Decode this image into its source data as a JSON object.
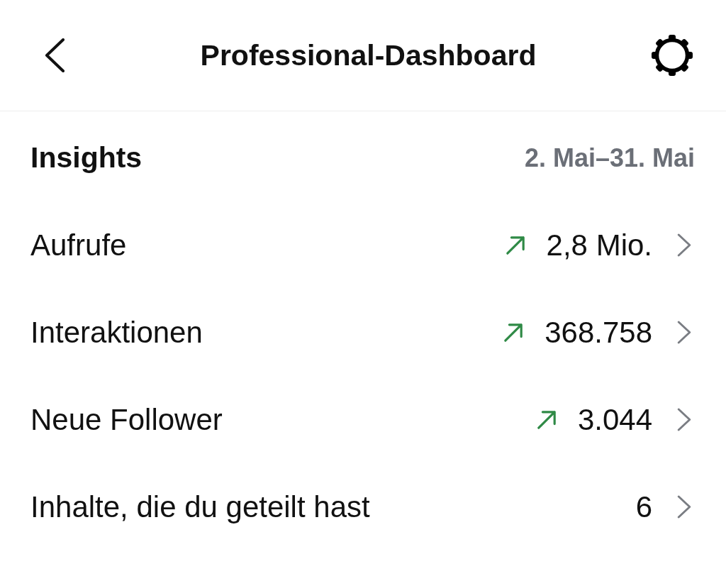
{
  "header": {
    "title": "Professional-Dashboard"
  },
  "insights": {
    "heading": "Insights",
    "date_range": "2. Mai–31. Mai",
    "rows": [
      {
        "label": "Aufrufe",
        "value": "2,8 Mio.",
        "trending_up": true
      },
      {
        "label": "Interaktionen",
        "value": "368.758",
        "trending_up": true
      },
      {
        "label": "Neue Follower",
        "value": "3.044",
        "trending_up": true
      },
      {
        "label": "Inhalte, die du geteilt hast",
        "value": "6",
        "trending_up": false
      }
    ]
  }
}
